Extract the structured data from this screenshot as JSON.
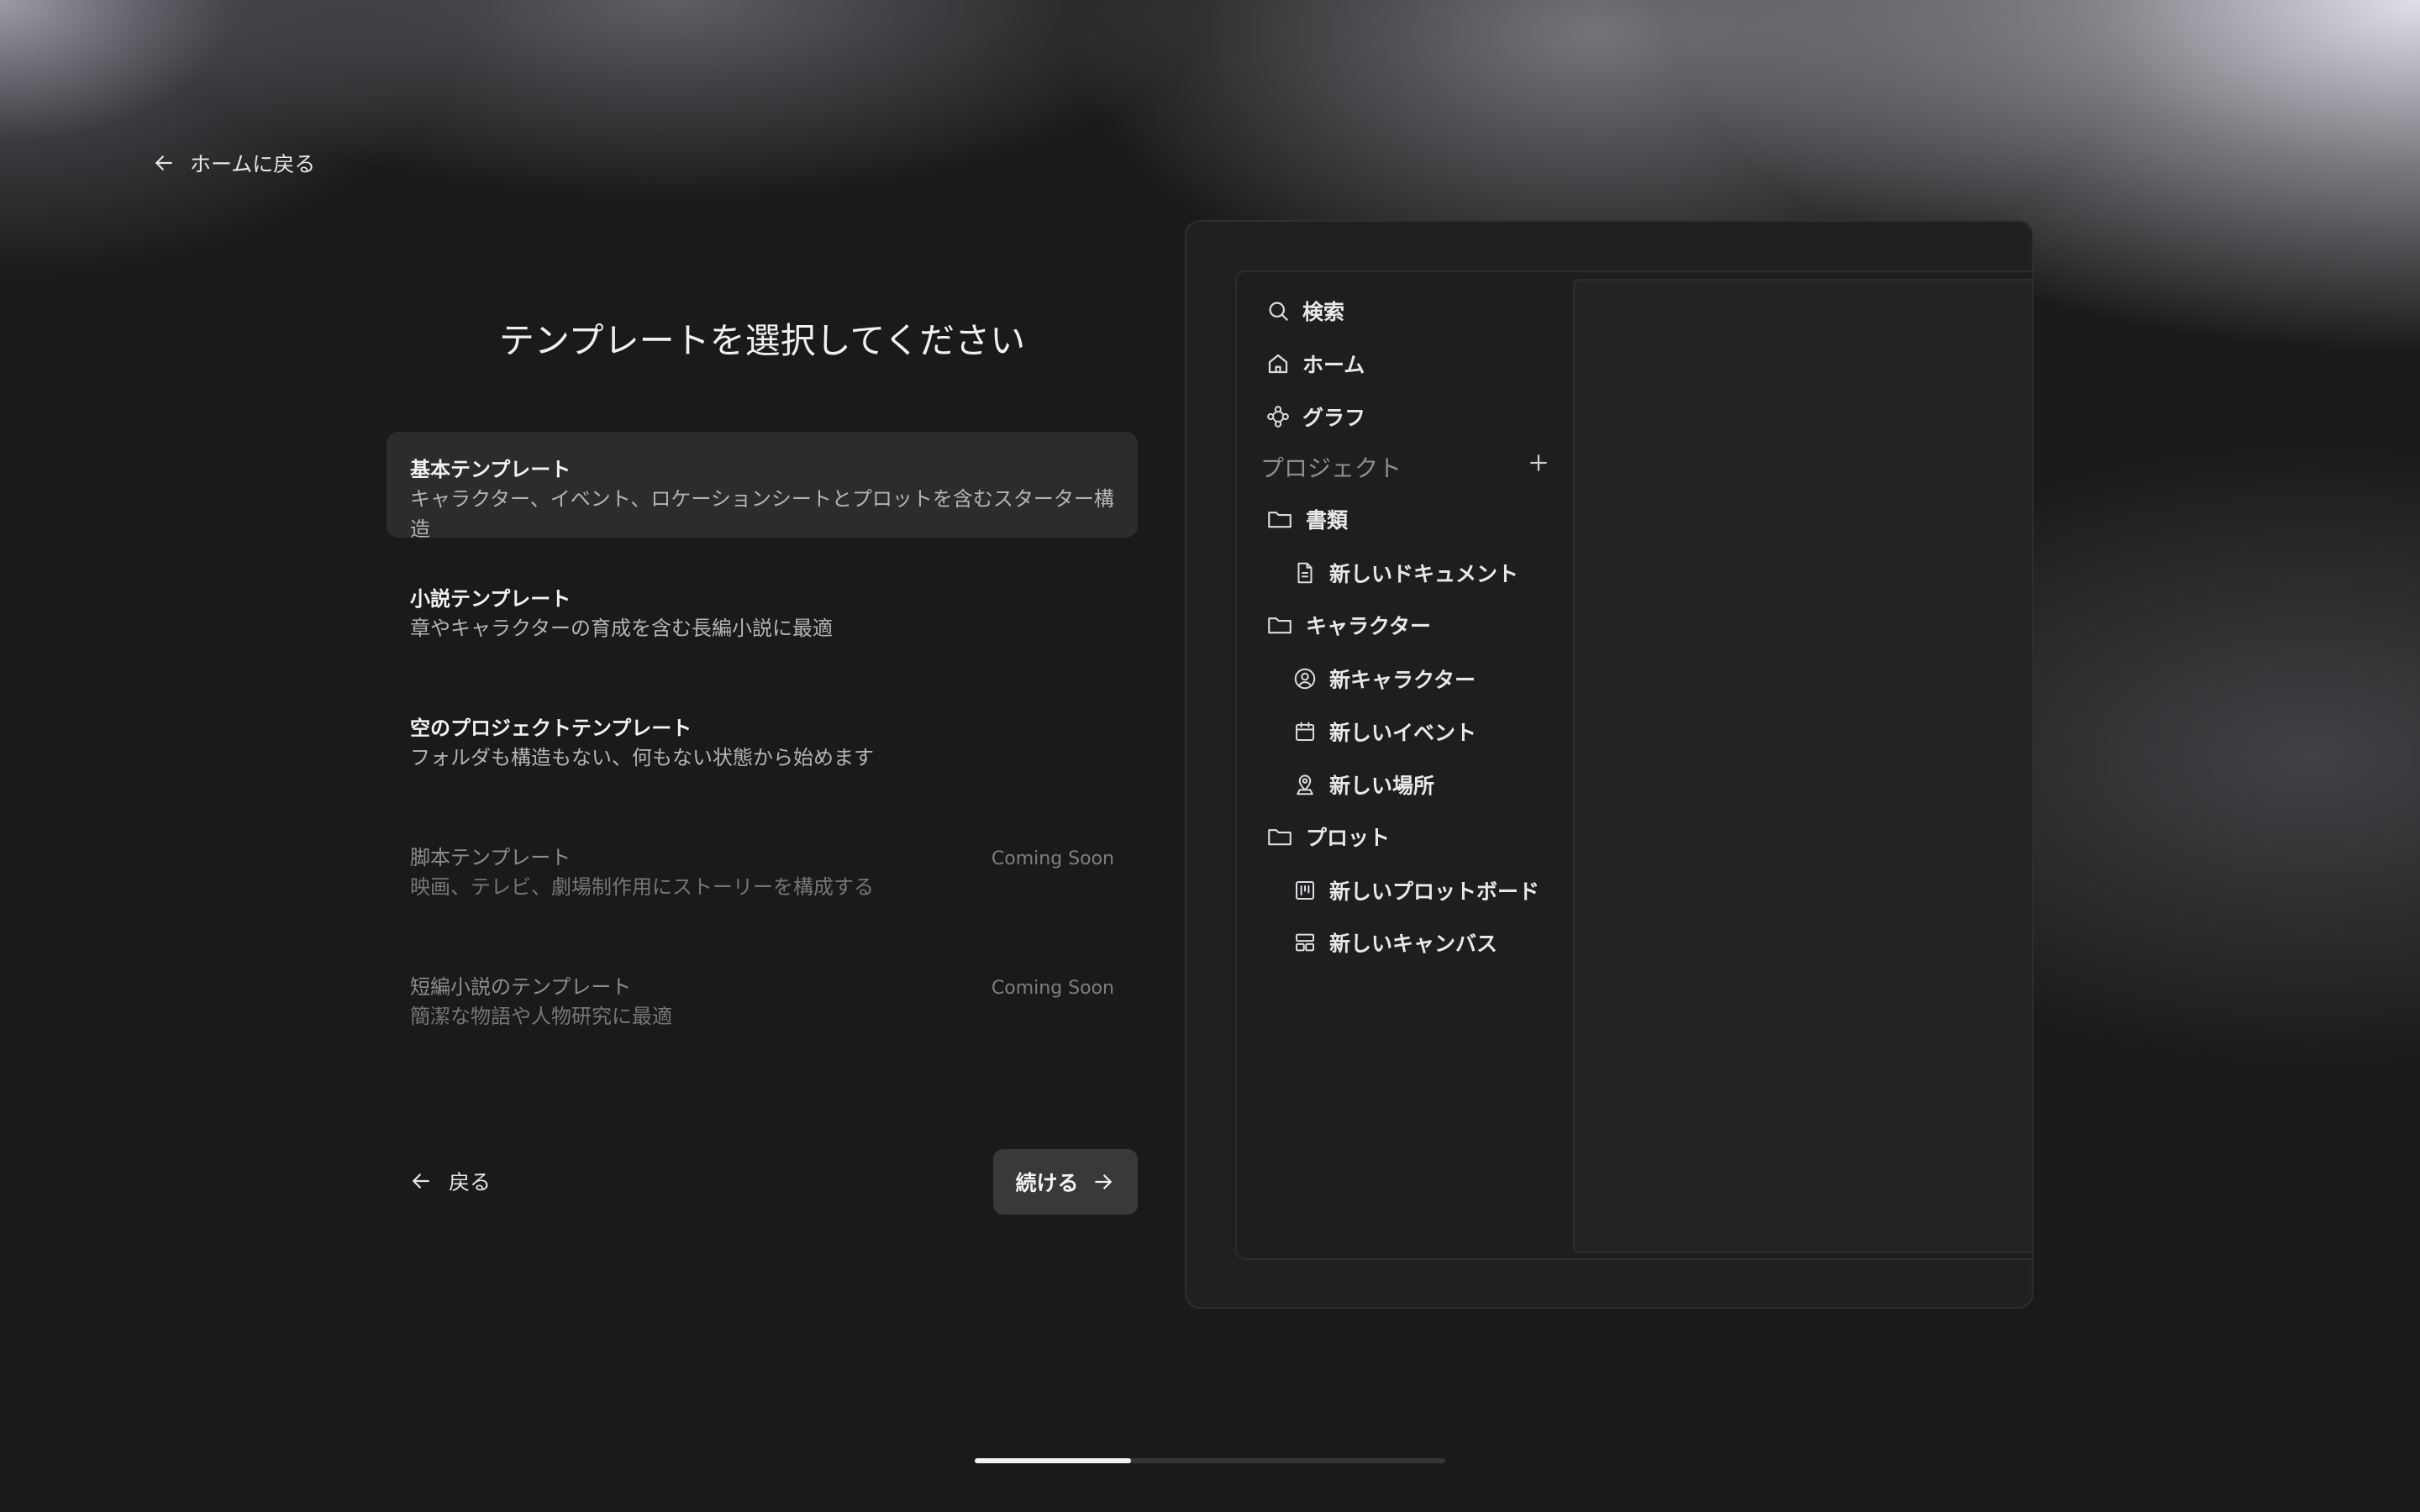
{
  "header": {
    "home_link_label": "ホームに戻る"
  },
  "page_title": "テンプレートを選択してください",
  "templates": [
    {
      "name": "基本テンプレート",
      "description": "キャラクター、イベント、ロケーションシートとプロットを含むスターター構造",
      "selected": true,
      "badge": ""
    },
    {
      "name": "小説テンプレート",
      "description": "章やキャラクターの育成を含む長編小説に最適",
      "selected": false,
      "badge": ""
    },
    {
      "name": "空のプロジェクトテンプレート",
      "description": "フォルダも構造もない、何もない状態から始めます",
      "selected": false,
      "badge": ""
    },
    {
      "name": "脚本テンプレート",
      "description": "映画、テレビ、劇場制作用にストーリーを構成する",
      "selected": false,
      "badge": "Coming Soon"
    },
    {
      "name": "短編小説のテンプレート",
      "description": "簡潔な物語や人物研究に最適",
      "selected": false,
      "badge": "Coming Soon"
    }
  ],
  "footer": {
    "back_label": "戻る",
    "continue_label": "続ける"
  },
  "preview": {
    "nav": {
      "search": "検索",
      "home": "ホーム",
      "graph": "グラフ"
    },
    "section_label": "プロジェクト",
    "tree": {
      "folder_documents": "書類",
      "new_document": "新しいドキュメント",
      "folder_characters": "キャラクター",
      "new_character": "新キャラクター",
      "new_event": "新しいイベント",
      "new_location": "新しい場所",
      "folder_plot": "プロット",
      "new_plotboard": "新しいプロットボード",
      "new_canvas": "新しいキャンバス"
    }
  },
  "progress": {
    "fraction": 0.333
  },
  "icons": {
    "home_link": "arrow-left-icon",
    "back": "arrow-left-icon",
    "continue": "arrow-right-icon",
    "search": "search-icon",
    "home": "home-icon",
    "graph": "graph-icon",
    "add": "plus-icon",
    "folder": "folder-icon",
    "document": "document-icon",
    "character": "user-circle-icon",
    "event": "calendar-icon",
    "location": "map-pin-icon",
    "plotboard": "kanban-icon",
    "canvas": "layout-icon"
  },
  "colors": {
    "background": "#1a1a1b",
    "selected_card": "#2c2c2e",
    "button": "#39393c",
    "accent_progress": "#f2f2f4"
  }
}
